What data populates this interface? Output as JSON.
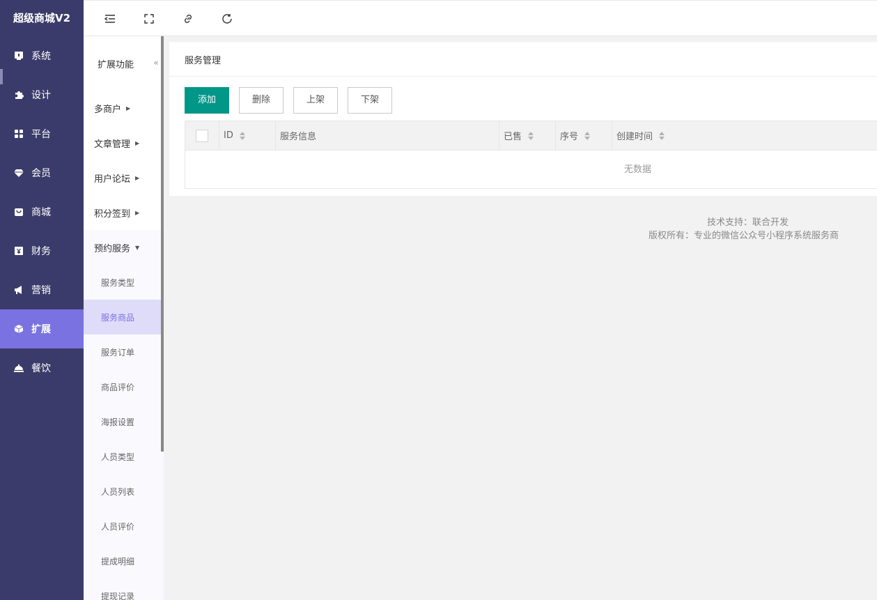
{
  "brand": "超级商城V2",
  "sidebar": {
    "items": [
      {
        "label": "系统",
        "icon": "store-icon"
      },
      {
        "label": "设计",
        "icon": "puzzle-icon"
      },
      {
        "label": "平台",
        "icon": "grid-icon"
      },
      {
        "label": "会员",
        "icon": "diamond-icon"
      },
      {
        "label": "商城",
        "icon": "bag-icon"
      },
      {
        "label": "财务",
        "icon": "yen-icon"
      },
      {
        "label": "营销",
        "icon": "megaphone-icon"
      },
      {
        "label": "扩展",
        "icon": "cube-icon",
        "active": true
      },
      {
        "label": "餐饮",
        "icon": "cloche-icon"
      }
    ]
  },
  "toolbar": {
    "icons": [
      "menu-fold-icon",
      "fullscreen-icon",
      "link-icon",
      "refresh-icon"
    ]
  },
  "subnav": {
    "title": "扩展功能",
    "collapse": "«",
    "groups": [
      {
        "label": "多商户"
      },
      {
        "label": "文章管理"
      },
      {
        "label": "用户论坛"
      },
      {
        "label": "积分签到"
      },
      {
        "label": "预约服务",
        "expanded": true
      }
    ],
    "items": [
      {
        "label": "服务类型"
      },
      {
        "label": "服务商品",
        "active": true
      },
      {
        "label": "服务订单"
      },
      {
        "label": "商品评价"
      },
      {
        "label": "海报设置"
      },
      {
        "label": "人员类型"
      },
      {
        "label": "人员列表"
      },
      {
        "label": "人员评价"
      },
      {
        "label": "提成明细"
      },
      {
        "label": "提现记录"
      }
    ]
  },
  "main": {
    "title": "服务管理",
    "buttons": {
      "add": "添加",
      "delete": "删除",
      "on_shelf": "上架",
      "off_shelf": "下架"
    },
    "table": {
      "columns": [
        "ID",
        "服务信息",
        "已售",
        "序号",
        "创建时间"
      ],
      "empty": "无数据"
    }
  },
  "footer": {
    "support": "技术支持：联合开发",
    "copyright": "版权所有：专业的微信公众号小程序系统服务商"
  },
  "colors": {
    "sidebar": "#3b3b6b",
    "accent": "#7a72e0",
    "primary_button": "#009688"
  }
}
